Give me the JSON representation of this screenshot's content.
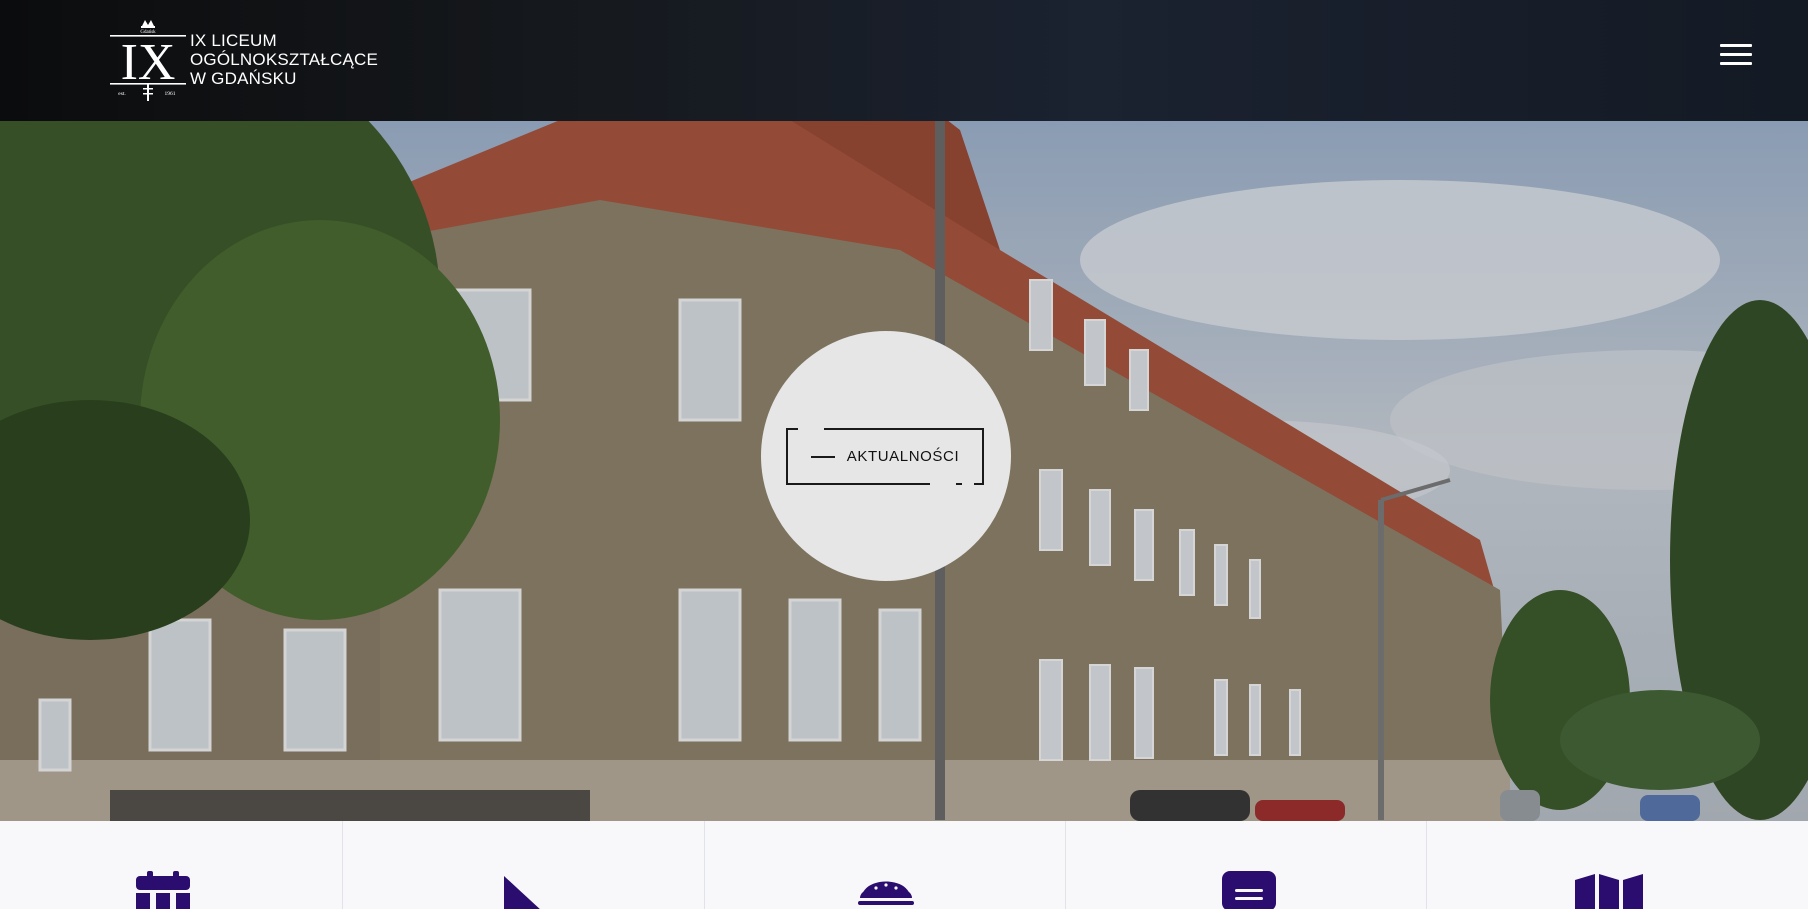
{
  "header": {
    "logo_lines": [
      "IX LICEUM",
      "OGÓLNOKSZTAŁCĄCE",
      "W GDAŃSKU"
    ],
    "logo_mark": {
      "letters": "IX",
      "city": "Gdańsk",
      "est": "est.",
      "year": "1961"
    },
    "menu_icon": "hamburger-menu-icon"
  },
  "hero": {
    "button_label": "AKTUALNOŚCI",
    "background": "school-building-photo"
  },
  "tiles": [
    {
      "icon": "calendar-icon"
    },
    {
      "icon": "triangle-ruler-icon"
    },
    {
      "icon": "burger-food-icon"
    },
    {
      "icon": "message-icon"
    },
    {
      "icon": "map-icon"
    }
  ],
  "colors": {
    "accent": "#2a0d6e",
    "nav_bg": "#111418",
    "badge_bg": "#e6e6e6",
    "tiles_bg": "#f8f8fb"
  }
}
